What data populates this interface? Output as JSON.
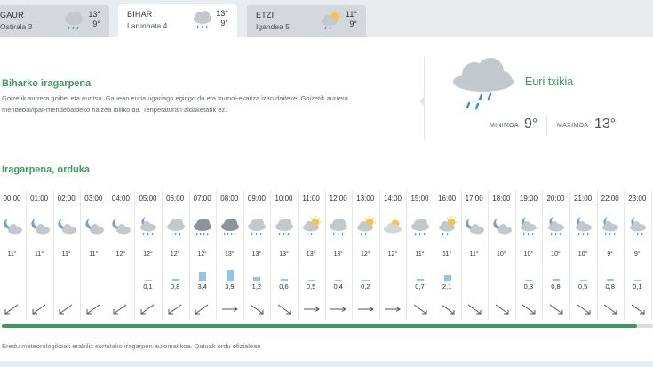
{
  "tabs": [
    {
      "day": "GAUR",
      "date": "Ostirala 3",
      "max": "13°",
      "min": "9°",
      "icon": "cloud-drizzle-icon",
      "active": false
    },
    {
      "day": "BIHAR",
      "date": "Larunbata 4",
      "max": "13°",
      "min": "9°",
      "icon": "cloud-drizzle-icon",
      "active": true
    },
    {
      "day": "ETZI",
      "date": "Igandea 5",
      "max": "11°",
      "min": "9°",
      "icon": "sun-cloud-rain-icon",
      "active": false
    }
  ],
  "summary": {
    "title": "Biharko iragarpena",
    "text": "Goizetik aurrera goibel eta euritsu. Gauean euria ugariago egingo du eta trumoi-ekaitza izan daiteke. Goizetik aurrera mendebal/ipar-mendebaldeko haizea ibiliko da. Tenperaturan aldaketarik ez.",
    "condition": "Euri txikia",
    "condition_icon": "cloud-rain-icon",
    "min_label": "MINIMOA",
    "min_value": "9°",
    "max_label": "MAXIMOA",
    "max_value": "13°"
  },
  "hourly": {
    "title": "Iragarpena, orduka",
    "hours": [
      {
        "time": "00:00",
        "icon": "moon-cloud",
        "temp": "11°",
        "rain": "",
        "rain_mm": 0,
        "wind": "sw"
      },
      {
        "time": "01:00",
        "icon": "moon-cloud",
        "temp": "11°",
        "rain": "",
        "rain_mm": 0,
        "wind": "sw"
      },
      {
        "time": "02:00",
        "icon": "moon-cloud",
        "temp": "11°",
        "rain": "",
        "rain_mm": 0,
        "wind": "sw"
      },
      {
        "time": "03:00",
        "icon": "moon-cloud",
        "temp": "11°",
        "rain": "",
        "rain_mm": 0,
        "wind": "sw"
      },
      {
        "time": "04:00",
        "icon": "moon-cloud",
        "temp": "12°",
        "rain": "",
        "rain_mm": 0,
        "wind": "sw"
      },
      {
        "time": "05:00",
        "icon": "moon-cloud-rain",
        "temp": "12°",
        "rain": "0,1",
        "rain_mm": 0.1,
        "wind": "sw"
      },
      {
        "time": "06:00",
        "icon": "cloud-rain",
        "temp": "12°",
        "rain": "0,8",
        "rain_mm": 0.8,
        "wind": "sw"
      },
      {
        "time": "07:00",
        "icon": "dark-cloud-rain",
        "temp": "12°",
        "rain": "3,4",
        "rain_mm": 3.4,
        "wind": "sw"
      },
      {
        "time": "08:00",
        "icon": "dark-cloud-rain",
        "temp": "13°",
        "rain": "3,9",
        "rain_mm": 3.9,
        "wind": "e"
      },
      {
        "time": "09:00",
        "icon": "cloud-rain",
        "temp": "13°",
        "rain": "1,2",
        "rain_mm": 1.2,
        "wind": "nw"
      },
      {
        "time": "10:00",
        "icon": "cloud-rain",
        "temp": "13°",
        "rain": "0,6",
        "rain_mm": 0.6,
        "wind": "nw"
      },
      {
        "time": "11:00",
        "icon": "sun-cloud-rain",
        "temp": "13°",
        "rain": "0,5",
        "rain_mm": 0.5,
        "wind": "e"
      },
      {
        "time": "12:00",
        "icon": "cloud-rain",
        "temp": "13°",
        "rain": "0,4",
        "rain_mm": 0.4,
        "wind": "e"
      },
      {
        "time": "13:00",
        "icon": "sun-cloud-rain",
        "temp": "12°",
        "rain": "0,2",
        "rain_mm": 0.2,
        "wind": "e"
      },
      {
        "time": "14:00",
        "icon": "sun-cloud",
        "temp": "12°",
        "rain": "",
        "rain_mm": 0,
        "wind": "e"
      },
      {
        "time": "15:00",
        "icon": "cloud-rain",
        "temp": "11°",
        "rain": "0,7",
        "rain_mm": 0.7,
        "wind": "nw"
      },
      {
        "time": "16:00",
        "icon": "sun-cloud-rain",
        "temp": "11°",
        "rain": "2,1",
        "rain_mm": 2.1,
        "wind": "nw"
      },
      {
        "time": "17:00",
        "icon": "moon-cloud",
        "temp": "11°",
        "rain": "",
        "rain_mm": 0,
        "wind": "nw"
      },
      {
        "time": "18:00",
        "icon": "moon-cloud",
        "temp": "10°",
        "rain": "",
        "rain_mm": 0,
        "wind": "nw"
      },
      {
        "time": "19:00",
        "icon": "moon-cloud-rain",
        "temp": "10°",
        "rain": "0,3",
        "rain_mm": 0.3,
        "wind": "nw"
      },
      {
        "time": "20:00",
        "icon": "moon-cloud-rain",
        "temp": "10°",
        "rain": "0,8",
        "rain_mm": 0.8,
        "wind": "nw"
      },
      {
        "time": "21:00",
        "icon": "moon-cloud-rain",
        "temp": "10°",
        "rain": "0,5",
        "rain_mm": 0.5,
        "wind": "nw"
      },
      {
        "time": "22:00",
        "icon": "moon-cloud-rain",
        "temp": "9°",
        "rain": "0,8",
        "rain_mm": 0.8,
        "wind": "nw"
      },
      {
        "time": "23:00",
        "icon": "moon-cloud-rain",
        "temp": "9°",
        "rain": "0,1",
        "rain_mm": 0.1,
        "wind": "nw"
      }
    ],
    "scroll_progress": 0.975
  },
  "footnote": "Eredu meteorologikoak erabiliz sortutako iragarpen automatikoa. Datuak ordu ofizialean",
  "colors": {
    "accent": "#3c9a5e",
    "rain_bar": "#8fc8e4",
    "rain_drop": "#3b8fd1",
    "cloud": "#bfc4c9"
  }
}
